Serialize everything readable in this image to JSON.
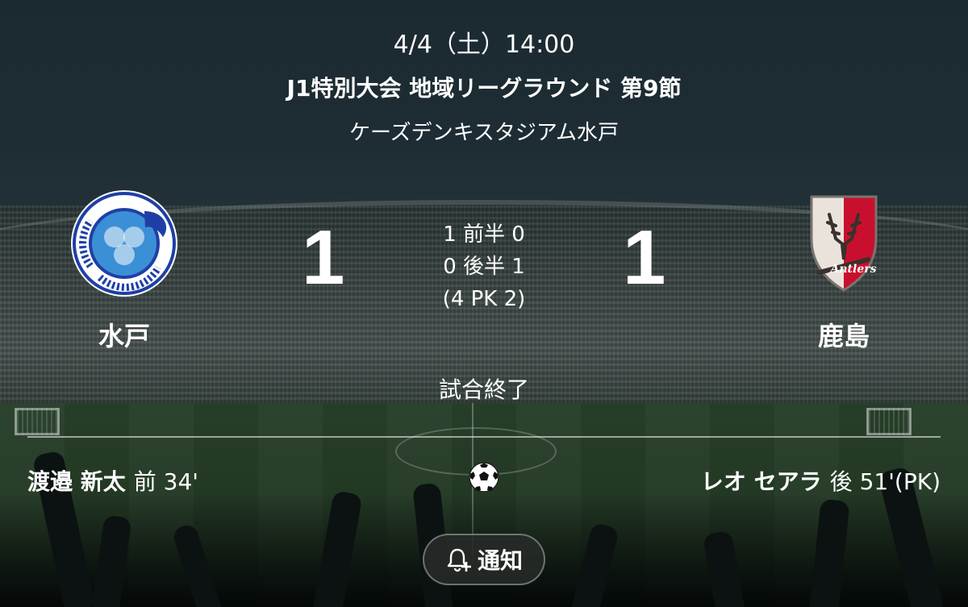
{
  "match": {
    "date": "4/4（土）14:00",
    "round": "J1特別大会 地域リーグラウンド 第9節",
    "venue": "ケーズデンキスタジアム水戸"
  },
  "home": {
    "name": "水戸",
    "score": "1",
    "crest_icon": "fc-mito-hollyhock-crest-icon",
    "crest_text": "FC MITO HOLLY HOCK · SINCE 1994 · IBARAKI",
    "color": "#1f3fa6"
  },
  "away": {
    "name": "鹿島",
    "score": "1",
    "crest_icon": "kashima-antlers-crest-icon",
    "crest_text": "KASHIMA Antlers",
    "color": "#c8102e"
  },
  "halves": {
    "first": "1 前半 0",
    "second": "0 後半 1",
    "pk": "(4  PK  2)"
  },
  "status": "試合終了",
  "goals": {
    "home": {
      "player": "渡邉 新太",
      "time": "前 34'"
    },
    "away": {
      "player": "レオ セアラ",
      "time": "後 51'(PK)"
    },
    "icon": "soccer-ball-icon"
  },
  "notify_button": {
    "label": "通知",
    "icon": "bell-plus-icon"
  }
}
